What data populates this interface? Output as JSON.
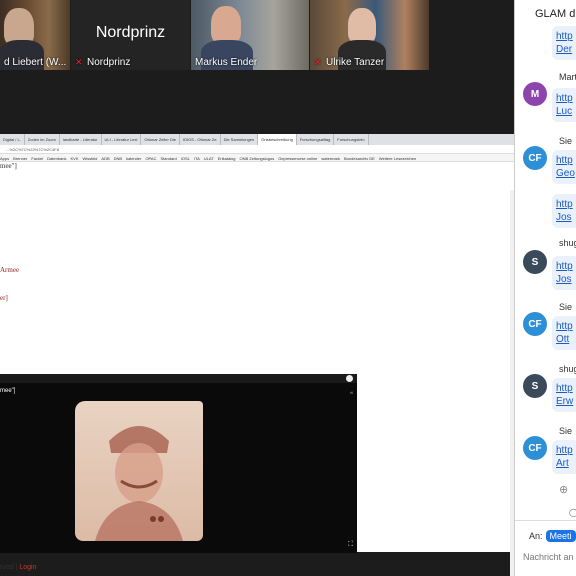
{
  "participants": [
    {
      "name": "d Liebert (W...",
      "muted": true
    },
    {
      "name": "Nordprinz",
      "center_name": "Nordprinz",
      "muted": true
    },
    {
      "name": "Markus Ender",
      "muted": false
    },
    {
      "name": "Ulrike Tanzer",
      "muted": true,
      "active": true
    }
  ],
  "browser": {
    "tabs": [
      "Digital / L.",
      "Zoden im Zoom",
      "landkarte - Literatur",
      "ULI - Literatur Lexi",
      "Ottonar Zeller Die",
      "IDIOS - Ottonar Ze",
      "Die Sammlungen",
      "Ortsbeschreibung",
      "Forschungsalltag",
      "Forschungsinfo"
    ],
    "url": "...%2C%7C%22%7C%2C4F8",
    "bookmarks": [
      "Apps",
      "Brenner",
      "Fackel",
      "Datenbank",
      "KVK",
      "Wissbild",
      "ADB",
      "DNB",
      "kalender",
      "OPAC",
      "Standard",
      "IOSL",
      "ITA",
      "ULAT",
      "Erlkatalog",
      "ONB Zeitungslogos",
      "Gepressenorse online",
      "watermark",
      "Bundesarchiv DE",
      "Weitere Lesezeichen"
    ]
  },
  "page": {
    "text_top": "mee\"]",
    "text_red1": "Armee",
    "text_red2": "er]",
    "viewer_caption": "mee\"]",
    "footer_reserved": "rved |",
    "footer_login": "Login"
  },
  "chat": {
    "title": "GLAM dig",
    "messages": [
      {
        "sender": "",
        "avatar": "",
        "links": [
          "http",
          "Der"
        ]
      },
      {
        "sender": "Mart",
        "avatar": "M",
        "avatar_color": "#8e44ad",
        "links": [
          "http",
          "Luc"
        ]
      },
      {
        "sender": "Sie",
        "avatar": "CF",
        "avatar_color": "#2d8fd5",
        "links": [
          "http",
          "Geo"
        ]
      },
      {
        "sender": "",
        "avatar": "",
        "links": [
          "http",
          "Jos"
        ]
      },
      {
        "sender": "shug",
        "avatar": "S",
        "avatar_color": "#3a4a5a",
        "links": [
          "http",
          "Jos"
        ]
      },
      {
        "sender": "Sie",
        "avatar": "CF",
        "avatar_color": "#2d8fd5",
        "links": [
          "http",
          "Ott"
        ]
      },
      {
        "sender": "shug",
        "avatar": "S",
        "avatar_color": "#3a4a5a",
        "links": [
          "http",
          "Erw"
        ]
      },
      {
        "sender": "Sie",
        "avatar": "CF",
        "avatar_color": "#2d8fd5",
        "links": [
          "http",
          "Art"
        ]
      }
    ],
    "to_label": "An:",
    "to_chip": "Meeti",
    "input_placeholder": "Nachricht an"
  }
}
